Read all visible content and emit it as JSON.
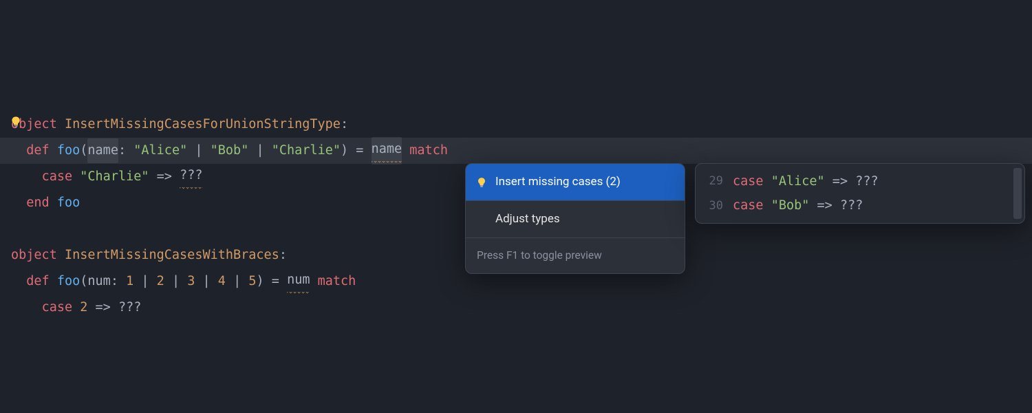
{
  "colors": {
    "accent_blue": "#1d5fbf",
    "bulb_body": "#ffcf4a",
    "bulb_base": "#8a8f99"
  },
  "code": {
    "line1": {
      "object_kw": "object",
      "name": "InsertMissingCasesForUnionStringType",
      "colon": ":"
    },
    "line2": {
      "indent": "  ",
      "def_kw": "def",
      "fn": "foo",
      "lparen": "(",
      "param": "name",
      "colon1": ": ",
      "t1": "\"Alice\"",
      "pipe1": " | ",
      "t2": "\"Bob\"",
      "pipe2": " | ",
      "t3": "\"Charlie\"",
      "rparen": ")",
      "eq": " = ",
      "subject": "name",
      "sp": " ",
      "match_kw": "match"
    },
    "line3": {
      "indent": "    ",
      "case_kw": "case",
      "sp1": " ",
      "lit": "\"Charlie\"",
      "arrow": " => ",
      "qqq": "???"
    },
    "line4": {
      "indent": "  ",
      "end_kw": "end",
      "sp": " ",
      "target": "foo"
    },
    "line6": {
      "object_kw": "object",
      "name": "InsertMissingCasesWithBraces",
      "colon": ":"
    },
    "line7": {
      "indent": "  ",
      "def_kw": "def",
      "fn": "foo",
      "lparen": "(",
      "param": "num",
      "colon1": ": ",
      "n1": "1",
      "p1": " | ",
      "n2": "2",
      "p2": " | ",
      "n3": "3",
      "p3": " | ",
      "n4": "4",
      "p4": " | ",
      "n5": "5",
      "rparen": ")",
      "eq": " = ",
      "subject": "num",
      "sp": " ",
      "match_kw": "match"
    },
    "line8": {
      "indent": "    ",
      "case_kw": "case",
      "sp1": " ",
      "lit": "2",
      "arrow": " => ",
      "qqq": "???"
    }
  },
  "quickfix": {
    "items": [
      {
        "label": "Insert missing cases (2)",
        "has_icon": true,
        "selected": true
      },
      {
        "label": "Adjust types",
        "has_icon": false,
        "selected": false
      }
    ],
    "footer": "Press F1 to toggle preview"
  },
  "preview": {
    "lines": [
      {
        "lineno": "29",
        "case_kw": "case",
        "sp1": " ",
        "lit": "\"Alice\"",
        "arrow": " => ",
        "qqq": "???"
      },
      {
        "lineno": "30",
        "case_kw": "case",
        "sp1": " ",
        "lit": "\"Bob\"",
        "arrow": " => ",
        "qqq": "???"
      }
    ]
  },
  "icons": {
    "bulb": "lightbulb-icon"
  }
}
